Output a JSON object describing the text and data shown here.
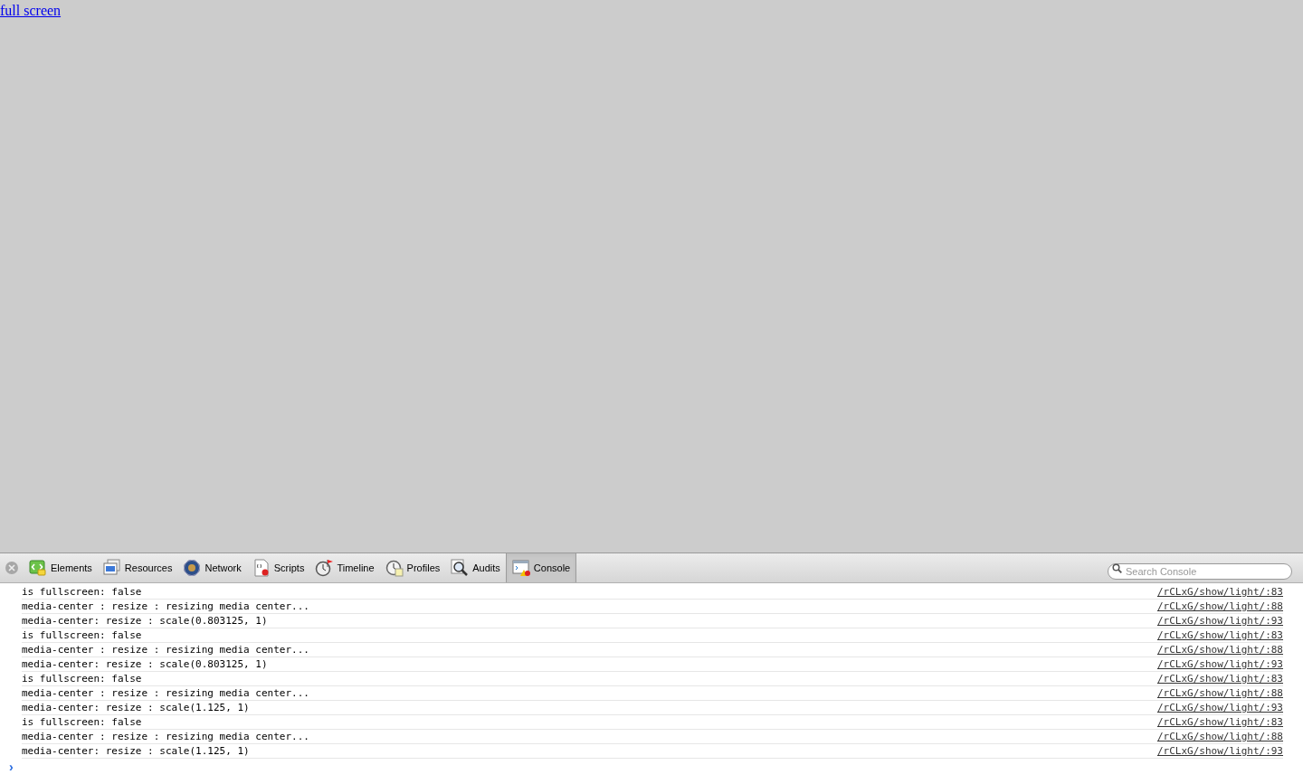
{
  "page": {
    "link": "full screen"
  },
  "toolbar": {
    "tabs": [
      {
        "label": "Elements",
        "kind": "elements",
        "selected": false
      },
      {
        "label": "Resources",
        "kind": "resources",
        "selected": false
      },
      {
        "label": "Network",
        "kind": "network",
        "selected": false
      },
      {
        "label": "Scripts",
        "kind": "scripts",
        "selected": false
      },
      {
        "label": "Timeline",
        "kind": "timeline",
        "selected": false
      },
      {
        "label": "Profiles",
        "kind": "profiles",
        "selected": false
      },
      {
        "label": "Audits",
        "kind": "audits",
        "selected": false
      },
      {
        "label": "Console",
        "kind": "console",
        "selected": true
      }
    ],
    "search": {
      "placeholder": "Search Console"
    }
  },
  "console": {
    "messages": [
      {
        "text": "is fullscreen: false",
        "source": "/rCLxG/show/light/:83"
      },
      {
        "text": "media-center : resize : resizing media center...",
        "source": "/rCLxG/show/light/:88"
      },
      {
        "text": "media-center: resize : scale(0.803125, 1)",
        "source": "/rCLxG/show/light/:93"
      },
      {
        "text": "is fullscreen: false",
        "source": "/rCLxG/show/light/:83"
      },
      {
        "text": "media-center : resize : resizing media center...",
        "source": "/rCLxG/show/light/:88"
      },
      {
        "text": "media-center: resize : scale(0.803125, 1)",
        "source": "/rCLxG/show/light/:93"
      },
      {
        "text": "is fullscreen: false",
        "source": "/rCLxG/show/light/:83"
      },
      {
        "text": "media-center : resize : resizing media center...",
        "source": "/rCLxG/show/light/:88"
      },
      {
        "text": "media-center: resize : scale(1.125, 1)",
        "source": "/rCLxG/show/light/:93"
      },
      {
        "text": "is fullscreen: false",
        "source": "/rCLxG/show/light/:83"
      },
      {
        "text": "media-center : resize : resizing media center...",
        "source": "/rCLxG/show/light/:88"
      },
      {
        "text": "media-center: resize : scale(1.125, 1)",
        "source": "/rCLxG/show/light/:93"
      }
    ],
    "prompt": "›"
  }
}
